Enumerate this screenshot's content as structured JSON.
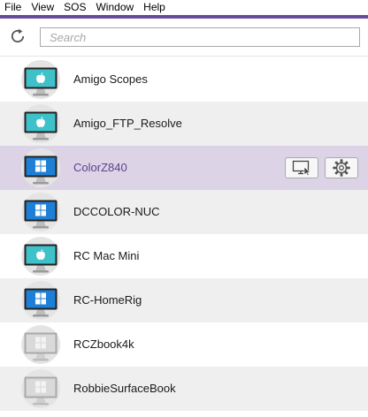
{
  "colors": {
    "accent": "#6a4a9c",
    "selected_row": "#dcd4e6",
    "selected_text": "#5a3f8c",
    "windows_blue": "#1e7fd6",
    "mac_teal": "#3fc1c9",
    "offline_gray": "#c9c9c9"
  },
  "menubar": {
    "items": [
      "File",
      "View",
      "SOS",
      "Window",
      "Help"
    ]
  },
  "toolbar": {
    "refresh_icon": "refresh-icon",
    "search": {
      "placeholder": "Search",
      "value": ""
    }
  },
  "devices": [
    {
      "name": "Amigo Scopes",
      "os": "mac",
      "status": "online",
      "selected": false
    },
    {
      "name": "Amigo_FTP_Resolve",
      "os": "mac",
      "status": "online",
      "selected": false
    },
    {
      "name": "ColorZ840",
      "os": "windows",
      "status": "online",
      "selected": true
    },
    {
      "name": "DCCOLOR-NUC",
      "os": "windows",
      "status": "online",
      "selected": false
    },
    {
      "name": "RC Mac Mini",
      "os": "mac",
      "status": "online",
      "selected": false
    },
    {
      "name": "RC-HomeRig",
      "os": "windows",
      "status": "online",
      "selected": false
    },
    {
      "name": "RCZbook4k",
      "os": "windows",
      "status": "offline",
      "selected": false
    },
    {
      "name": "RobbieSurfaceBook",
      "os": "windows",
      "status": "offline",
      "selected": false
    }
  ],
  "selected_row_actions": {
    "connect_icon": "remote-control-icon",
    "settings_icon": "gear-icon"
  }
}
